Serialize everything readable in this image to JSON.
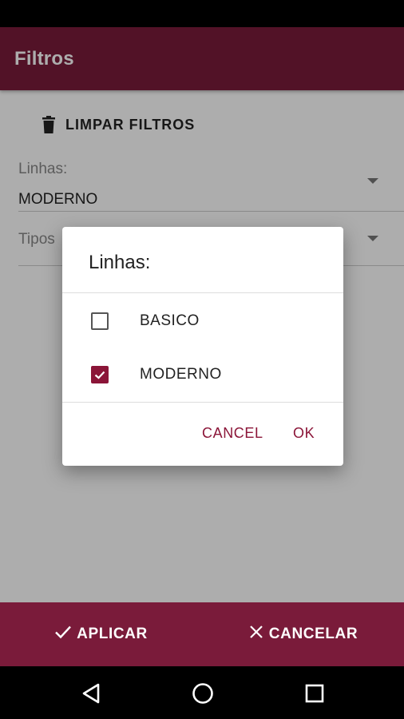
{
  "appbar": {
    "title": "Filtros"
  },
  "clear_filters": {
    "label": "LIMPAR FILTROS",
    "icon": "trash-icon"
  },
  "fields": {
    "lines": {
      "label": "Linhas:",
      "value": "MODERNO"
    },
    "types": {
      "label": "Tipos"
    }
  },
  "dialog": {
    "title": "Linhas:",
    "options": [
      {
        "label": "BASICO",
        "checked": false
      },
      {
        "label": "MODERNO",
        "checked": true
      }
    ],
    "cancel_label": "CANCEL",
    "ok_label": "OK"
  },
  "bottom_bar": {
    "apply_label": "APLICAR",
    "cancel_label": "CANCELAR"
  },
  "colors": {
    "primary": "#7a1b3a",
    "accent": "#8b1538"
  },
  "navbar": {
    "icons": [
      "back-icon",
      "home-icon",
      "recent-apps-icon"
    ]
  }
}
